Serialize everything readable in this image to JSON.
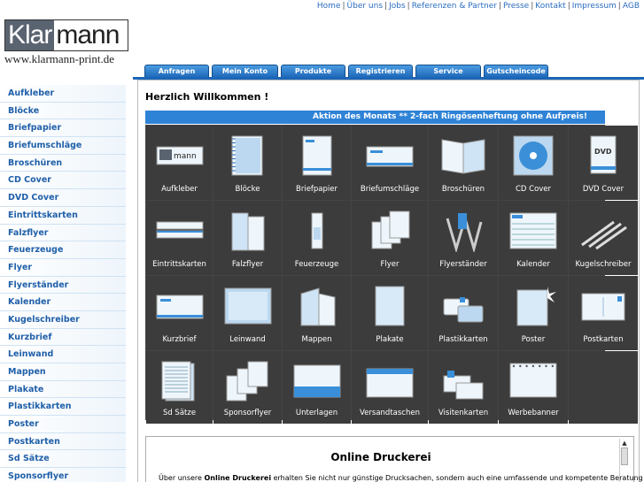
{
  "topnav": [
    "Home",
    "Über uns",
    "Jobs",
    "Referenzen & Partner",
    "Presse",
    "Kontakt",
    "Impressum",
    "AGB"
  ],
  "logo": {
    "klar": "Klar",
    "mann": "mann",
    "url": "www.klarmann-print.de"
  },
  "tabs": [
    "Anfragen",
    "Mein Konto",
    "Produkte",
    "Registrieren",
    "Service",
    "Gutscheincode"
  ],
  "sidebar": [
    "Aufkleber",
    "Blöcke",
    "Briefpapier",
    "Briefumschläge",
    "Broschüren",
    "CD Cover",
    "DVD Cover",
    "Eintrittskarten",
    "Falzflyer",
    "Feuerzeuge",
    "Flyer",
    "Flyerständer",
    "Kalender",
    "Kugelschreiber",
    "Kurzbrief",
    "Leinwand",
    "Mappen",
    "Plakate",
    "Plastikkarten",
    "Poster",
    "Postkarten",
    "Sd Sätze",
    "Sponsorflyer"
  ],
  "main": {
    "welcome": "Herzlich Willkommen !",
    "promo": "Aktion des Monats ** 2-fach Ringösenheftung ohne Aufpreis!"
  },
  "products": [
    {
      "label": "Aufkleber",
      "icon": "sticker-icon"
    },
    {
      "label": "Blöcke",
      "icon": "notepad-icon"
    },
    {
      "label": "Briefpapier",
      "icon": "letterhead-icon"
    },
    {
      "label": "Briefumschläge",
      "icon": "envelope-icon"
    },
    {
      "label": "Broschüren",
      "icon": "brochure-icon"
    },
    {
      "label": "CD Cover",
      "icon": "cd-icon"
    },
    {
      "label": "DVD Cover",
      "icon": "dvd-icon"
    },
    {
      "label": "Eintrittskarten",
      "icon": "ticket-icon"
    },
    {
      "label": "Falzflyer",
      "icon": "folded-flyer-icon"
    },
    {
      "label": "Feuerzeuge",
      "icon": "lighter-icon"
    },
    {
      "label": "Flyer",
      "icon": "flyer-icon"
    },
    {
      "label": "Flyerständer",
      "icon": "flyer-stand-icon"
    },
    {
      "label": "Kalender",
      "icon": "calendar-icon"
    },
    {
      "label": "Kugelschreiber",
      "icon": "pen-icon"
    },
    {
      "label": "Kurzbrief",
      "icon": "short-letter-icon"
    },
    {
      "label": "Leinwand",
      "icon": "canvas-icon"
    },
    {
      "label": "Mappen",
      "icon": "folder-icon"
    },
    {
      "label": "Plakate",
      "icon": "poster-sheet-icon"
    },
    {
      "label": "Plastikkarten",
      "icon": "plastic-card-icon"
    },
    {
      "label": "Poster",
      "icon": "poster-icon"
    },
    {
      "label": "Postkarten",
      "icon": "postcard-icon"
    },
    {
      "label": "Sd Sätze",
      "icon": "form-set-icon"
    },
    {
      "label": "Sponsorflyer",
      "icon": "sponsor-flyer-icon"
    },
    {
      "label": "Unterlagen",
      "icon": "desk-pad-icon"
    },
    {
      "label": "Versandtaschen",
      "icon": "mailing-bag-icon"
    },
    {
      "label": "Visitenkarten",
      "icon": "business-card-icon"
    },
    {
      "label": "Werbebanner",
      "icon": "banner-icon"
    }
  ],
  "info": {
    "title": "Online Druckerei",
    "pre": "Über unsere ",
    "bold": "Online Druckerei",
    "post": " erhalten Sie nicht nur günstige Drucksachen, sondern auch eine umfassende und kompetente Beratung"
  },
  "colors": {
    "accent": "#2f83d6",
    "link": "#1f5fa8",
    "tile_bg": "#3c3c3c"
  }
}
